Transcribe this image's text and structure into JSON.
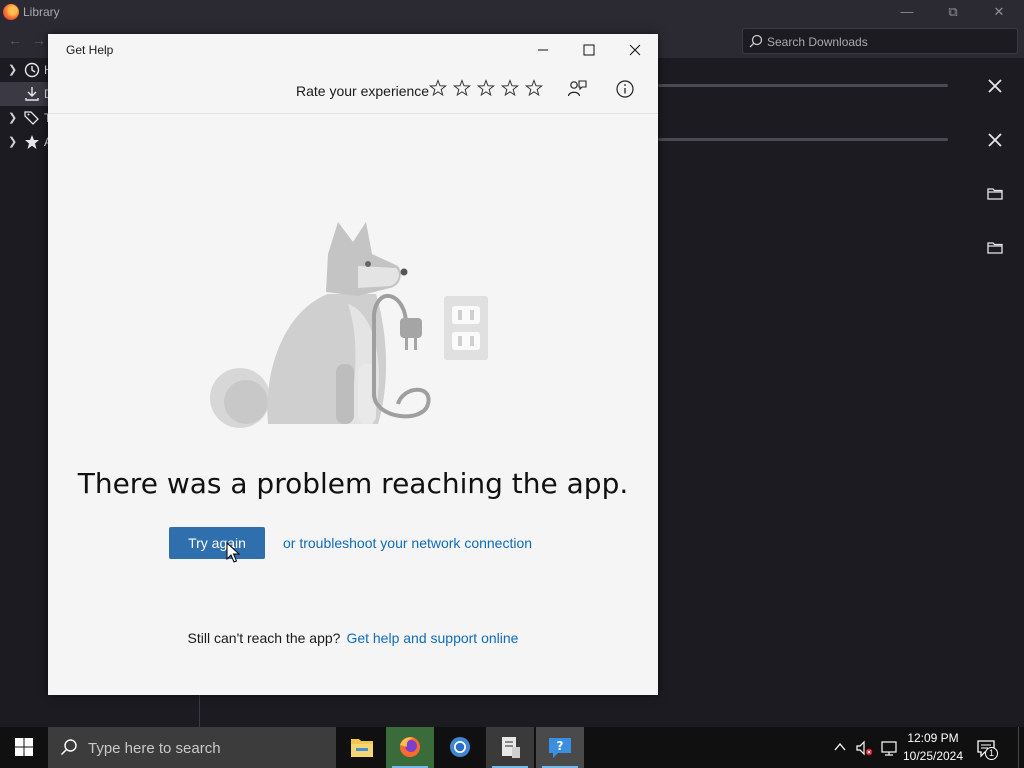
{
  "library": {
    "title": "Library",
    "search_placeholder": "Search Downloads",
    "sidebar": [
      {
        "icon": "history-icon",
        "label": "H"
      },
      {
        "icon": "downloads-icon",
        "label": "D"
      },
      {
        "icon": "tags-icon",
        "label": "T"
      },
      {
        "icon": "star-icon",
        "label": "A"
      }
    ]
  },
  "gethelp": {
    "title": "Get Help",
    "rate_label": "Rate your experience",
    "rating": 0,
    "message": "There was a problem reaching the app.",
    "try_again": "Try again",
    "troubleshoot": "or troubleshoot your network connection",
    "still": "Still can't reach the app?",
    "support": "Get help and support online",
    "link_color": "#0f6cbd",
    "button_color": "#2f6fad"
  },
  "taskbar": {
    "search_placeholder": "Type here to search",
    "time": "12:09 PM",
    "date": "10/25/2024",
    "notification_count": "1"
  }
}
